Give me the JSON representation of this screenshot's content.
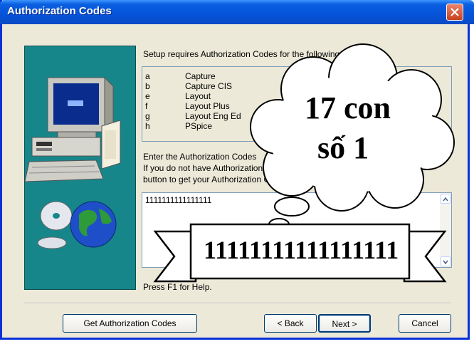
{
  "window": {
    "title": "Authorization Codes"
  },
  "intro_text": "Setup requires Authorization Codes for the following products:",
  "products": [
    {
      "key": "a",
      "name": "Capture"
    },
    {
      "key": "b",
      "name": "Capture CIS"
    },
    {
      "key": "e",
      "name": "Layout"
    },
    {
      "key": "f",
      "name": "Layout Plus"
    },
    {
      "key": "g",
      "name": "Layout Eng Ed"
    },
    {
      "key": "h",
      "name": "PSpice"
    }
  ],
  "instructions": {
    "line1": "Enter the Authorization Codes",
    "line2": "If you do not have Authorization",
    "line3": "button to get your Authorization Code"
  },
  "codes_input": {
    "value": "1111111111111111"
  },
  "help_text": "Press F1 for Help.",
  "buttons": {
    "get_codes": "Get Authorization Codes",
    "back": "< Back",
    "next": "Next >",
    "cancel": "Cancel"
  },
  "annotation": {
    "bubble_line1": "17 con",
    "bubble_line2": "số 1",
    "banner": "11111111111111111"
  },
  "colors": {
    "titlebar": "#0553d9",
    "side_panel": "#17868a",
    "dialog_bg": "#ece9d8"
  }
}
